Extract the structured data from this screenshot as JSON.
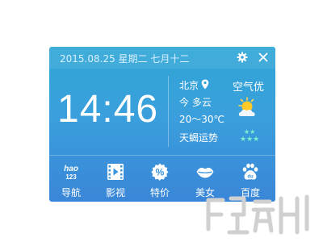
{
  "header": {
    "date": "2015.08.25 星期二 七月十二"
  },
  "clock": {
    "time": "14:46"
  },
  "weather": {
    "city": "北京",
    "air_quality": "空气优",
    "today": "今 多云",
    "temperature": "20～30℃",
    "condition_icon": "cloud-sun-icon"
  },
  "horoscope": {
    "label": "天蝎运势",
    "stars_top": "★★",
    "stars_bottom": "★★★"
  },
  "nav": {
    "items": [
      {
        "label": "导航",
        "icon": "hao123-icon"
      },
      {
        "label": "影视",
        "icon": "film-icon"
      },
      {
        "label": "特价",
        "icon": "percent-icon"
      },
      {
        "label": "美女",
        "icon": "lips-icon"
      },
      {
        "label": "百度",
        "icon": "baidu-paw-icon"
      }
    ]
  },
  "colors": {
    "panel_top": "#2fa6d6",
    "panel_bottom": "#3a86d8",
    "stars": "#7ef0d0"
  }
}
